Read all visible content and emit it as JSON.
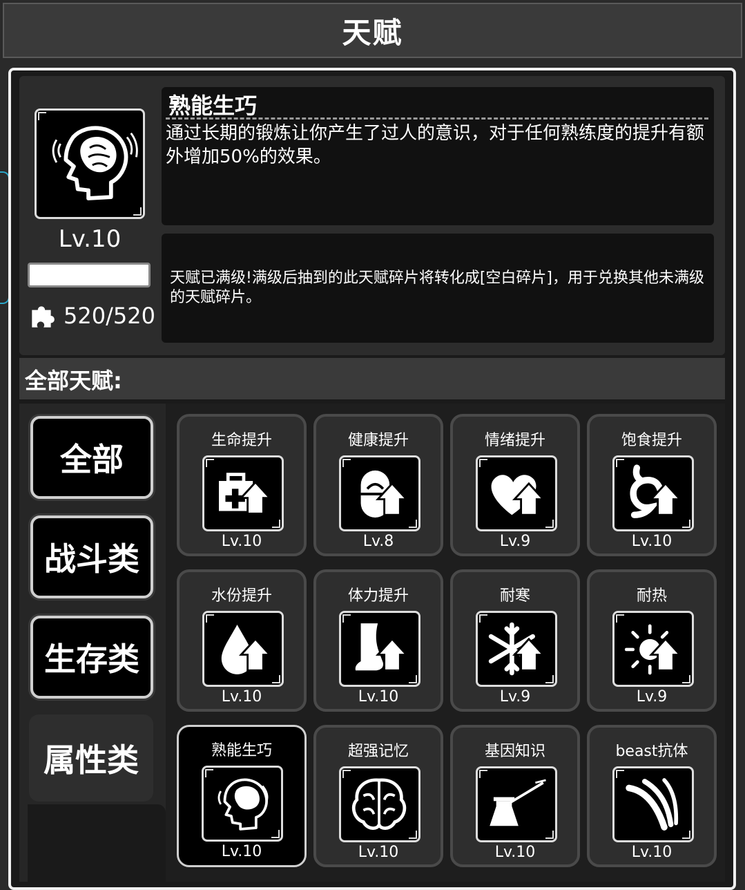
{
  "header": {
    "title": "天赋"
  },
  "detail": {
    "icon": "brain-head-icon",
    "level": "Lv.10",
    "progress": 1.0,
    "fragment_icon": "puzzle-piece-icon",
    "fragments": "520/520",
    "name": "熟能生巧",
    "description": "通过长期的锻炼让你产生了过人的意识，对于任何熟练度的提升有额外增加50%的效果。",
    "note": "天赋已满级!满级后抽到的此天赋碎片将转化成[空白碎片]，用于兑换其他未满级的天赋碎片。"
  },
  "section": {
    "label": "全部天赋:"
  },
  "categories": [
    {
      "label": "全部"
    },
    {
      "label": "战斗类"
    },
    {
      "label": "生存类"
    },
    {
      "label": "属性类",
      "active": true
    }
  ],
  "talents": [
    {
      "name": "生命提升",
      "level": "Lv.10",
      "icon": "first-aid-kit-up-icon"
    },
    {
      "name": "健康提升",
      "level": "Lv.8",
      "icon": "pill-up-icon"
    },
    {
      "name": "情绪提升",
      "level": "Lv.9",
      "icon": "heart-up-icon"
    },
    {
      "name": "饱食提升",
      "level": "Lv.10",
      "icon": "stomach-up-icon"
    },
    {
      "name": "水份提升",
      "level": "Lv.10",
      "icon": "water-drop-up-icon"
    },
    {
      "name": "体力提升",
      "level": "Lv.10",
      "icon": "leg-up-icon"
    },
    {
      "name": "耐寒",
      "level": "Lv.9",
      "icon": "snowflake-up-icon"
    },
    {
      "name": "耐热",
      "level": "Lv.9",
      "icon": "sun-up-icon"
    },
    {
      "name": "熟能生巧",
      "level": "Lv.10",
      "icon": "brain-head-icon",
      "selected": true
    },
    {
      "name": "超强记忆",
      "level": "Lv.10",
      "icon": "brain-icon"
    },
    {
      "name": "基因知识",
      "level": "Lv.10",
      "icon": "flask-syringe-icon"
    },
    {
      "name": "beast抗体",
      "level": "Lv.10",
      "icon": "claw-scratch-icon"
    }
  ]
}
